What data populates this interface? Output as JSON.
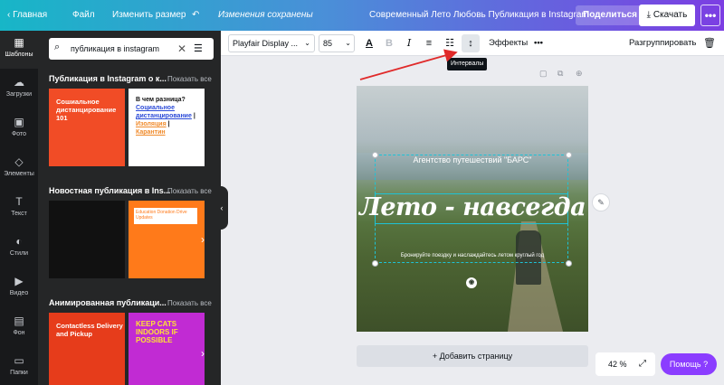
{
  "topbar": {
    "home": "Главная",
    "file": "Файл",
    "resize": "Изменить размер",
    "status": "Изменения сохранены",
    "title": "Современный Лето Любовь Публикация в Instagram",
    "share": "Поделиться",
    "download": "Скачать",
    "more": "•••"
  },
  "rail": [
    {
      "label": "Шаблоны",
      "icon": "grid-icon"
    },
    {
      "label": "Загрузки",
      "icon": "cloud-upload-icon"
    },
    {
      "label": "Фото",
      "icon": "camera-icon"
    },
    {
      "label": "Элементы",
      "icon": "shapes-icon"
    },
    {
      "label": "Текст",
      "icon": "text-icon"
    },
    {
      "label": "Стили",
      "icon": "palette-icon"
    },
    {
      "label": "Видео",
      "icon": "video-icon"
    },
    {
      "label": "Фон",
      "icon": "background-icon"
    },
    {
      "label": "Папки",
      "icon": "folder-icon"
    }
  ],
  "panel": {
    "search_value": "публикация в instagram",
    "show_all": "Показать все",
    "sections": [
      {
        "title": "Публикация в Instagram о к..."
      },
      {
        "title": "Новостная публикация в Ins..."
      },
      {
        "title": "Анимированная публикаци..."
      }
    ],
    "thumbs": {
      "t1": "Сошиальное дистанцирование 101",
      "t2_q": "В чем разница?",
      "t2_a": "Социальное дистанцирование",
      "t2_b": "Изоляция",
      "t2_c": "Карантин",
      "t4": "Education Donation Drive Updates",
      "t5": "Contactless Delivery and Pickup",
      "t6": "KEEP CATS INDOORS IF POSSIBLE"
    }
  },
  "toolbar": {
    "font": "Playfair Display ...",
    "size": "85",
    "effects": "Эффекты",
    "more": "•••",
    "ungroup": "Разгруппировать",
    "tooltip": "Интервалы"
  },
  "canvas": {
    "agency": "Агентство путешествий \"БАРС\"",
    "headline": "Лето - навсегда",
    "subtext": "Бронируйте поездку и наслаждайтесь летом круглый год",
    "add_page": "+ Добавить страницу",
    "zoom": "42 %",
    "help": "Помощь ?"
  }
}
